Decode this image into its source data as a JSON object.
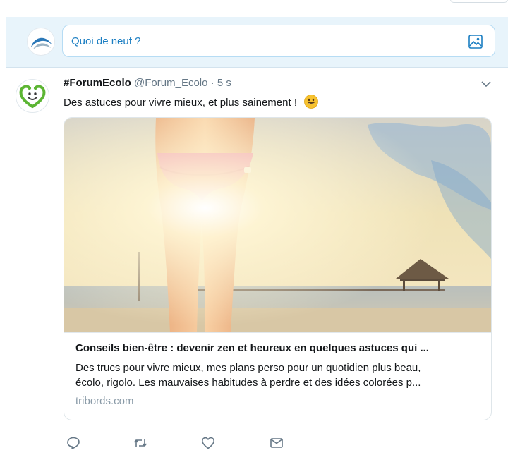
{
  "composer": {
    "placeholder": "Quoi de neuf ?",
    "avatar_icon": "logo-avatar",
    "media_icon": "image-icon"
  },
  "tweet": {
    "name": "#ForumEcolo",
    "handle": "@Forum_Ecolo",
    "separator": "·",
    "time": "5 s",
    "text": "Des astuces pour vivre mieux, et plus sainement !",
    "emoji": "smiley-emoji",
    "menu_icon": "chevron-down-icon",
    "card": {
      "title": "Conseils bien-être : devenir zen et heureux en quelques astuces qui ...",
      "description_line1": "Des trucs pour vivre mieux, mes plans perso pour un quotidien plus beau,",
      "description_line2": "écolo, rigolo. Les mauvaises habitudes à perdre et des idées colorées p...",
      "domain": "tribords.com"
    },
    "actions": [
      "reply-icon",
      "retweet-icon",
      "like-icon",
      "message-icon"
    ]
  },
  "colors": {
    "accent": "#1b7ec2",
    "composer_bg": "#e8f4fb",
    "muted": "#657786",
    "logo_green": "#5cb533"
  }
}
